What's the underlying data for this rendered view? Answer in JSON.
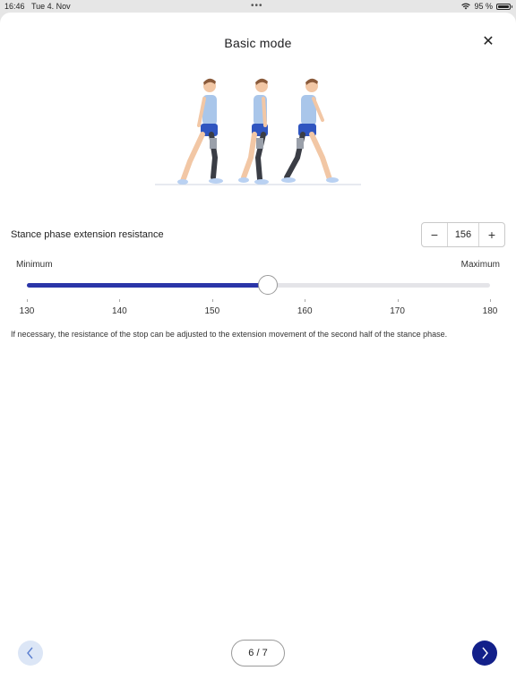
{
  "statusbar": {
    "time": "16:46",
    "date": "Tue 4. Nov",
    "battery": "95 %",
    "icons": [
      "wifi-icon",
      "battery-icon"
    ]
  },
  "sheet": {
    "title": "Basic mode",
    "close_icon": "close-icon"
  },
  "setting": {
    "label": "Stance phase extension resistance",
    "value": "156",
    "minus_label": "−",
    "plus_label": "+"
  },
  "slider": {
    "min_label": "Minimum",
    "max_label": "Maximum",
    "min": 130,
    "max": 180,
    "value": 156,
    "ticks": [
      "130",
      "140",
      "150",
      "160",
      "170",
      "180"
    ]
  },
  "description": "If necessary, the resistance of the stop can be adjusted to the extension movement of the second half of the stance phase.",
  "nav": {
    "page": "6 / 7",
    "prev_icon": "chevron-left-icon",
    "next_icon": "chevron-right-icon"
  },
  "colors": {
    "accent": "#2b35a8",
    "next_button": "#13208a",
    "prev_button": "#dce6f6",
    "track": "#e4e4e8"
  }
}
